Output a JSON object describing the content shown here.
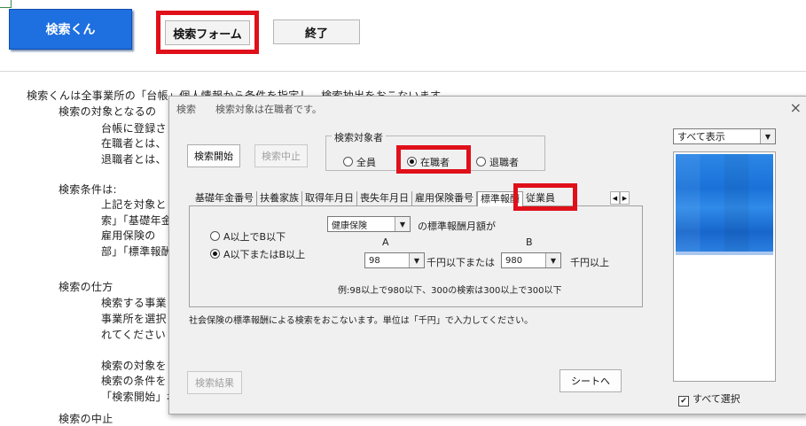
{
  "sheet": {
    "main_button": "検索くん",
    "form_button": "検索フォーム",
    "exit_button": "終了",
    "doc_lines": [
      "検索くんは全事業所の「台帳」個人情報から条件を指定し、検索抽出をおこないます。",
      "検索の対象となるの",
      "台帳に登録さ",
      "在職者とは、",
      "退職者とは、",
      "検索条件は:",
      "上記を対象と",
      "索」「基礎年金",
      "雇用保険の",
      "部」「標準報酬",
      "検索の仕方",
      "検索する事業",
      "事業所を選択",
      "れてください",
      "検索の対象を",
      "検索の条件を",
      "「検索開始」ボ",
      "検索の中止"
    ]
  },
  "dialog": {
    "title": "検索　　検索対象は在職者です。",
    "close": "×",
    "start_button": "検索開始",
    "stop_button": "検索中止",
    "target_group": {
      "legend": "検索対象者",
      "options": [
        "全員",
        "在職者",
        "退職者"
      ],
      "selected": "在職者"
    },
    "tabs": [
      "基礎年金番号",
      "扶養家族",
      "取得年月日",
      "喪失年月日",
      "雇用保険番号",
      "標準報酬",
      "従業員"
    ],
    "active_tab": "標準報酬",
    "tab_scroll": [
      "◀",
      "▶"
    ],
    "panel": {
      "insurance_select": "健康保険",
      "insurance_suffix": "の標準報酬月額が",
      "range_options": [
        "A以上でB以下",
        "A以下またはB以上"
      ],
      "range_selected": "A以下またはB以上",
      "label_a": "A",
      "label_b": "B",
      "value_a": "98",
      "value_b": "980",
      "text_mid": "千円以下または",
      "text_end": "千円以上",
      "example": "例:98以上で980以下、300の検索は300以上で300以下"
    },
    "hint": "社会保険の標準報酬による検索をおこないます。単位は「千円」で入力してください。",
    "results_button": "検索結果",
    "sheet_button": "シートへ",
    "display_select": "すべて表示",
    "select_all_label": "すべて選択",
    "select_all_checked": true
  },
  "colors": {
    "accent_blue": "#1e6fe0",
    "highlight_red": "#e0101a"
  }
}
